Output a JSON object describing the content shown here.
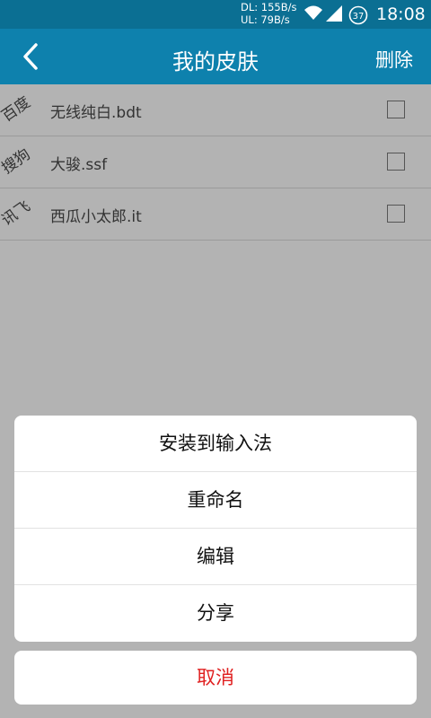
{
  "status_bar": {
    "download": "DL: 155B/s",
    "upload": "UL: 79B/s",
    "battery": "37",
    "time": "18:08"
  },
  "title_bar": {
    "title": "我的皮肤",
    "delete_label": "删除",
    "back_icon": "chevron-left-icon"
  },
  "list": {
    "items": [
      {
        "source": "百度",
        "name": "无线纯白.bdt"
      },
      {
        "source": "搜狗",
        "name": "大骏.ssf"
      },
      {
        "source": "讯飞",
        "name": "西瓜小太郎.it"
      }
    ]
  },
  "action_sheet": {
    "items": [
      "安装到输入法",
      "重命名",
      "编辑",
      "分享"
    ],
    "cancel": "取消"
  },
  "colors": {
    "status_bar": "#0b6f93",
    "title_bar": "#0e81ad",
    "cancel_text": "#e02020"
  }
}
